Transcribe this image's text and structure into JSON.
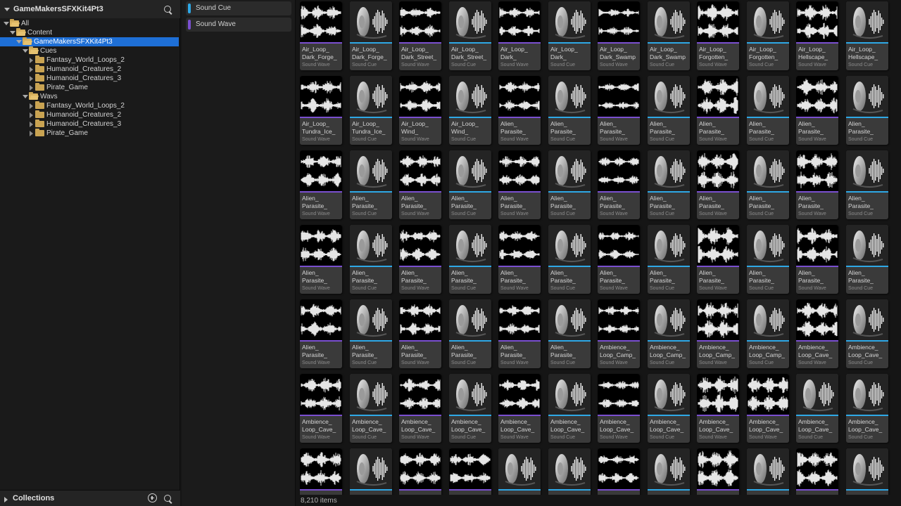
{
  "tree_header": {
    "title": "GameMakersSFXKit4Pt3"
  },
  "tree": [
    {
      "label": "All",
      "depth": 0,
      "expanded": true,
      "selected": false
    },
    {
      "label": "Content",
      "depth": 1,
      "expanded": true,
      "selected": false
    },
    {
      "label": "GameMakersSFXKit4Pt3",
      "depth": 2,
      "expanded": true,
      "selected": true
    },
    {
      "label": "Cues",
      "depth": 3,
      "expanded": true,
      "selected": false
    },
    {
      "label": "Fantasy_World_Loops_2",
      "depth": 4,
      "expanded": false,
      "selected": false
    },
    {
      "label": "Humanoid_Creatures_2",
      "depth": 4,
      "expanded": false,
      "selected": false
    },
    {
      "label": "Humanoid_Creatures_3",
      "depth": 4,
      "expanded": false,
      "selected": false
    },
    {
      "label": "Pirate_Game",
      "depth": 4,
      "expanded": false,
      "selected": false
    },
    {
      "label": "Wavs",
      "depth": 3,
      "expanded": true,
      "selected": false
    },
    {
      "label": "Fantasy_World_Loops_2",
      "depth": 4,
      "expanded": false,
      "selected": false
    },
    {
      "label": "Humanoid_Creatures_2",
      "depth": 4,
      "expanded": false,
      "selected": false
    },
    {
      "label": "Humanoid_Creatures_3",
      "depth": 4,
      "expanded": false,
      "selected": false
    },
    {
      "label": "Pirate_Game",
      "depth": 4,
      "expanded": false,
      "selected": false
    }
  ],
  "collections": {
    "title": "Collections"
  },
  "filters": [
    {
      "label": "Sound Cue",
      "color": "#2ea8e6"
    },
    {
      "label": "Sound Wave",
      "color": "#7a4fd0"
    }
  ],
  "type_colors": {
    "Sound Wave": "#7a4fd0",
    "Sound Cue": "#2ea8e6"
  },
  "assets": [
    [
      {
        "name": [
          "Air_Loop_",
          "Dark_Forge_"
        ],
        "type": "Sound Wave"
      },
      {
        "name": [
          "Air_Loop_",
          "Dark_Forge_"
        ],
        "type": "Sound Cue"
      },
      {
        "name": [
          "Air_Loop_",
          "Dark_Street_"
        ],
        "type": "Sound Wave"
      },
      {
        "name": [
          "Air_Loop_",
          "Dark_Street_"
        ],
        "type": "Sound Cue"
      },
      {
        "name": [
          "Air_Loop_",
          "Dark_"
        ],
        "type": "Sound Wave"
      },
      {
        "name": [
          "Air_Loop_",
          "Dark_"
        ],
        "type": "Sound Cue"
      },
      {
        "name": [
          "Air_Loop_",
          "Dark_Swamp"
        ],
        "type": "Sound Wave"
      },
      {
        "name": [
          "Air_Loop_",
          "Dark_Swamp"
        ],
        "type": "Sound Cue"
      },
      {
        "name": [
          "Air_Loop_",
          "Forgotten_"
        ],
        "type": "Sound Wave"
      },
      {
        "name": [
          "Air_Loop_",
          "Forgotten_"
        ],
        "type": "Sound Cue"
      },
      {
        "name": [
          "Air_Loop_",
          "Hellscape_"
        ],
        "type": "Sound Wave"
      },
      {
        "name": [
          "Air_Loop_",
          "Hellscape_"
        ],
        "type": "Sound Cue"
      }
    ],
    [
      {
        "name": [
          "Air_Loop_",
          "Tundra_Ice_"
        ],
        "type": "Sound Wave"
      },
      {
        "name": [
          "Air_Loop_",
          "Tundra_Ice_"
        ],
        "type": "Sound Cue"
      },
      {
        "name": [
          "Air_Loop_",
          "Wind_"
        ],
        "type": "Sound Wave"
      },
      {
        "name": [
          "Air_Loop_",
          "Wind_"
        ],
        "type": "Sound Cue"
      },
      {
        "name": [
          "Alien_",
          "Parasite_"
        ],
        "type": "Sound Wave"
      },
      {
        "name": [
          "Alien_",
          "Parasite_"
        ],
        "type": "Sound Cue"
      },
      {
        "name": [
          "Alien_",
          "Parasite_"
        ],
        "type": "Sound Wave"
      },
      {
        "name": [
          "Alien_",
          "Parasite_"
        ],
        "type": "Sound Cue"
      },
      {
        "name": [
          "Alien_",
          "Parasite_"
        ],
        "type": "Sound Wave"
      },
      {
        "name": [
          "Alien_",
          "Parasite_"
        ],
        "type": "Sound Cue"
      },
      {
        "name": [
          "Alien_",
          "Parasite_"
        ],
        "type": "Sound Wave"
      },
      {
        "name": [
          "Alien_",
          "Parasite_"
        ],
        "type": "Sound Cue"
      }
    ],
    [
      {
        "name": [
          "Alien_",
          "Parasite_"
        ],
        "type": "Sound Wave"
      },
      {
        "name": [
          "Alien_",
          "Parasite_"
        ],
        "type": "Sound Cue"
      },
      {
        "name": [
          "Alien_",
          "Parasite_"
        ],
        "type": "Sound Wave"
      },
      {
        "name": [
          "Alien_",
          "Parasite_"
        ],
        "type": "Sound Cue"
      },
      {
        "name": [
          "Alien_",
          "Parasite_"
        ],
        "type": "Sound Wave"
      },
      {
        "name": [
          "Alien_",
          "Parasite_"
        ],
        "type": "Sound Cue"
      },
      {
        "name": [
          "Alien_",
          "Parasite_"
        ],
        "type": "Sound Wave"
      },
      {
        "name": [
          "Alien_",
          "Parasite_"
        ],
        "type": "Sound Cue"
      },
      {
        "name": [
          "Alien_",
          "Parasite_"
        ],
        "type": "Sound Wave"
      },
      {
        "name": [
          "Alien_",
          "Parasite_"
        ],
        "type": "Sound Cue"
      },
      {
        "name": [
          "Alien_",
          "Parasite_"
        ],
        "type": "Sound Wave"
      },
      {
        "name": [
          "Alien_",
          "Parasite_"
        ],
        "type": "Sound Cue"
      }
    ],
    [
      {
        "name": [
          "Alien_",
          "Parasite_"
        ],
        "type": "Sound Wave"
      },
      {
        "name": [
          "Alien_",
          "Parasite_"
        ],
        "type": "Sound Cue"
      },
      {
        "name": [
          "Alien_",
          "Parasite_"
        ],
        "type": "Sound Wave"
      },
      {
        "name": [
          "Alien_",
          "Parasite_"
        ],
        "type": "Sound Cue"
      },
      {
        "name": [
          "Alien_",
          "Parasite_"
        ],
        "type": "Sound Wave"
      },
      {
        "name": [
          "Alien_",
          "Parasite_"
        ],
        "type": "Sound Cue"
      },
      {
        "name": [
          "Alien_",
          "Parasite_"
        ],
        "type": "Sound Wave"
      },
      {
        "name": [
          "Alien_",
          "Parasite_"
        ],
        "type": "Sound Cue"
      },
      {
        "name": [
          "Alien_",
          "Parasite_"
        ],
        "type": "Sound Wave"
      },
      {
        "name": [
          "Alien_",
          "Parasite_"
        ],
        "type": "Sound Cue"
      },
      {
        "name": [
          "Alien_",
          "Parasite_"
        ],
        "type": "Sound Wave"
      },
      {
        "name": [
          "Alien_",
          "Parasite_"
        ],
        "type": "Sound Cue"
      }
    ],
    [
      {
        "name": [
          "Alien_",
          "Parasite_"
        ],
        "type": "Sound Wave"
      },
      {
        "name": [
          "Alien_",
          "Parasite_"
        ],
        "type": "Sound Cue"
      },
      {
        "name": [
          "Alien_",
          "Parasite_"
        ],
        "type": "Sound Wave"
      },
      {
        "name": [
          "Alien_",
          "Parasite_"
        ],
        "type": "Sound Cue"
      },
      {
        "name": [
          "Alien_",
          "Parasite_"
        ],
        "type": "Sound Wave"
      },
      {
        "name": [
          "Alien_",
          "Parasite_"
        ],
        "type": "Sound Cue"
      },
      {
        "name": [
          "Ambience_",
          "Loop_Camp_"
        ],
        "type": "Sound Wave"
      },
      {
        "name": [
          "Ambience_",
          "Loop_Camp_"
        ],
        "type": "Sound Cue"
      },
      {
        "name": [
          "Ambience_",
          "Loop_Camp_"
        ],
        "type": "Sound Wave"
      },
      {
        "name": [
          "Ambience_",
          "Loop_Camp_"
        ],
        "type": "Sound Cue"
      },
      {
        "name": [
          "Ambience_",
          "Loop_Cave_"
        ],
        "type": "Sound Wave"
      },
      {
        "name": [
          "Ambience_",
          "Loop_Cave_"
        ],
        "type": "Sound Cue"
      }
    ],
    [
      {
        "name": [
          "Ambience_",
          "Loop_Cave_"
        ],
        "type": "Sound Wave"
      },
      {
        "name": [
          "Ambience_",
          "Loop_Cave_"
        ],
        "type": "Sound Cue"
      },
      {
        "name": [
          "Ambience_",
          "Loop_Cave_"
        ],
        "type": "Sound Wave"
      },
      {
        "name": [
          "Ambience_",
          "Loop_Cave_"
        ],
        "type": "Sound Cue"
      },
      {
        "name": [
          "Ambience_",
          "Loop_Cave_"
        ],
        "type": "Sound Wave"
      },
      {
        "name": [
          "Ambience_",
          "Loop_Cave_"
        ],
        "type": "Sound Cue"
      },
      {
        "name": [
          "Ambience_",
          "Loop_Cave_"
        ],
        "type": "Sound Wave"
      },
      {
        "name": [
          "Ambience_",
          "Loop_Cave_"
        ],
        "type": "Sound Cue"
      },
      {
        "name": [
          "Ambience_",
          "Loop_Cave_"
        ],
        "type": "Sound Wave"
      },
      {
        "name": [
          "Ambience_",
          "Loop_Cave_"
        ],
        "type": "Sound Wave"
      },
      {
        "name": [
          "Ambience_",
          "Loop_Cave_"
        ],
        "type": "Sound Cue"
      },
      {
        "name": [
          "Ambience_",
          "Loop_Cave_"
        ],
        "type": "Sound Cue"
      }
    ],
    [
      {
        "name": [
          "",
          ""
        ],
        "type": "Sound Wave"
      },
      {
        "name": [
          "",
          ""
        ],
        "type": "Sound Cue"
      },
      {
        "name": [
          "",
          ""
        ],
        "type": "Sound Wave"
      },
      {
        "name": [
          "",
          ""
        ],
        "type": "Sound Wave"
      },
      {
        "name": [
          "",
          ""
        ],
        "type": "Sound Cue"
      },
      {
        "name": [
          "",
          ""
        ],
        "type": "Sound Cue"
      },
      {
        "name": [
          "",
          ""
        ],
        "type": "Sound Wave"
      },
      {
        "name": [
          "",
          ""
        ],
        "type": "Sound Cue"
      },
      {
        "name": [
          "",
          ""
        ],
        "type": "Sound Wave"
      },
      {
        "name": [
          "",
          ""
        ],
        "type": "Sound Cue"
      },
      {
        "name": [
          "",
          ""
        ],
        "type": "Sound Wave"
      },
      {
        "name": [
          "",
          ""
        ],
        "type": "Sound Cue"
      }
    ]
  ],
  "status": {
    "item_count": "8,210 items"
  }
}
